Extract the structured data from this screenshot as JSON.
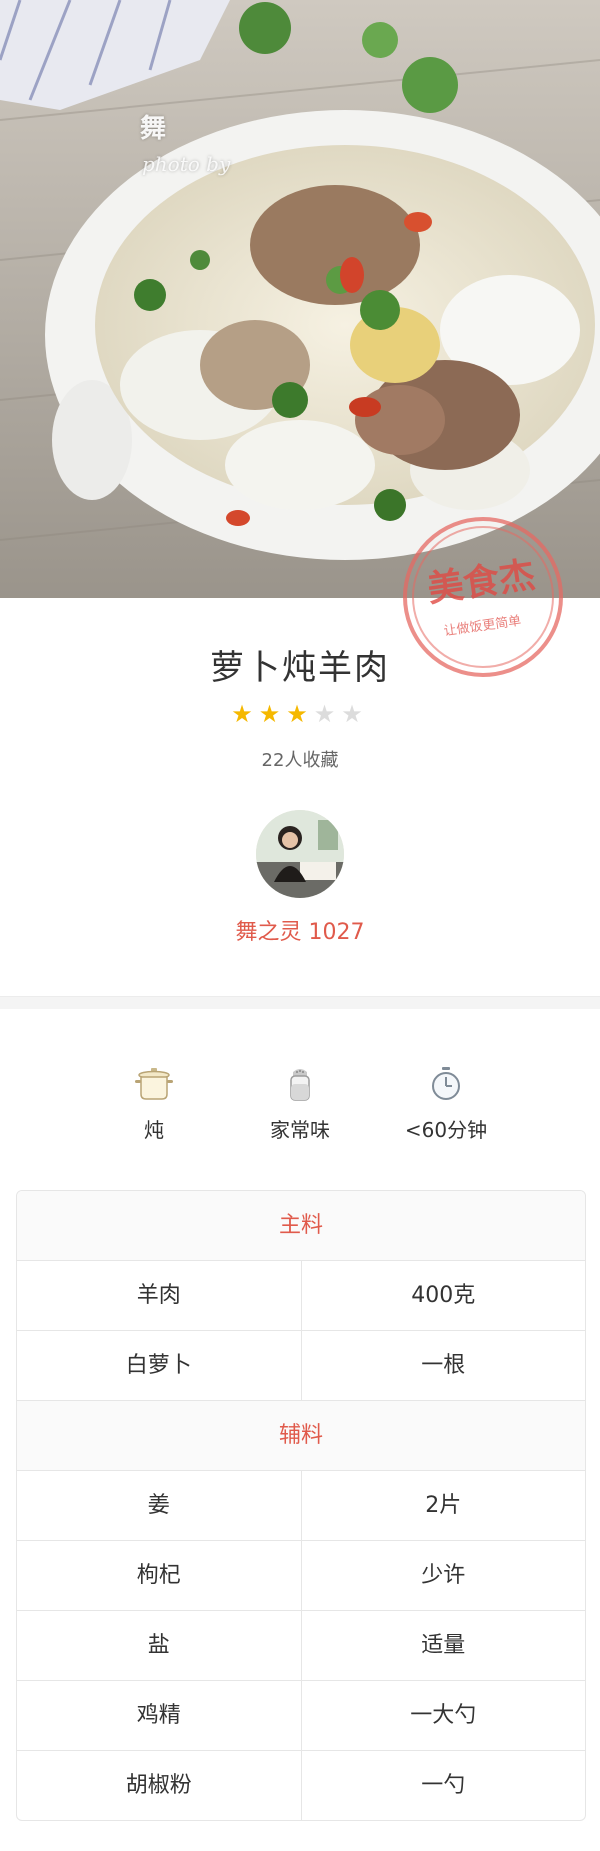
{
  "hero": {
    "watermark_char": "舞",
    "watermark_text": "photo by",
    "stamp_text": "美食杰",
    "stamp_sub": "让做饭更简单"
  },
  "recipe": {
    "title": "萝卜炖羊肉",
    "rating": 3,
    "rating_max": 5,
    "favorites": "22人收藏",
    "author": "舞之灵 1027"
  },
  "info": [
    {
      "icon": "pot-icon",
      "label": "炖"
    },
    {
      "icon": "seasoning-jar-icon",
      "label": "家常味"
    },
    {
      "icon": "clock-icon",
      "label": "<60分钟"
    }
  ],
  "ingredients": {
    "main_title": "主料",
    "main": [
      {
        "name": "羊肉",
        "amount": "400克"
      },
      {
        "name": "白萝卜",
        "amount": "一根"
      }
    ],
    "aux_title": "辅料",
    "aux": [
      {
        "name": "姜",
        "amount": "2片"
      },
      {
        "name": "枸杞",
        "amount": "少许"
      },
      {
        "name": "盐",
        "amount": "适量"
      },
      {
        "name": "鸡精",
        "amount": "一大勺"
      },
      {
        "name": "胡椒粉",
        "amount": "一勺"
      }
    ]
  },
  "colors": {
    "accent": "#e05a4b",
    "star": "#f5b800"
  }
}
